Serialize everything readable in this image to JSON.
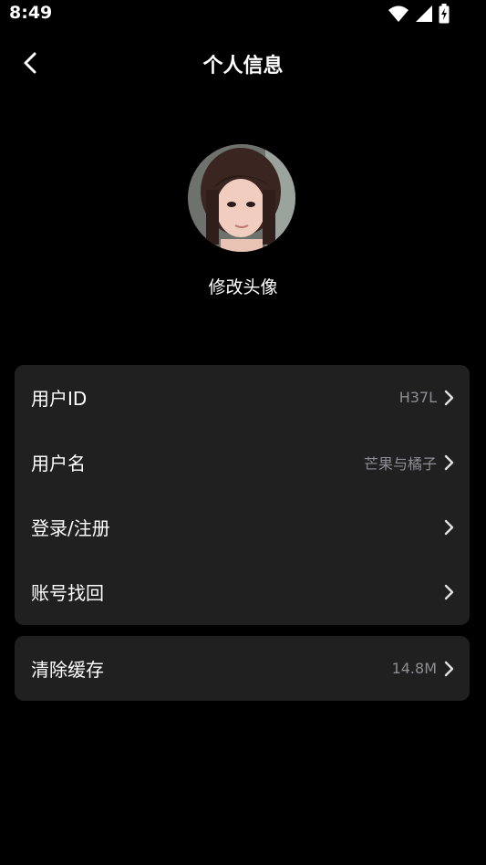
{
  "status_bar": {
    "time": "8:49",
    "icons": [
      "wifi-icon",
      "signal-icon",
      "battery-charging-icon"
    ]
  },
  "header": {
    "back_icon": "chevron-left-icon",
    "title": "个人信息"
  },
  "profile": {
    "change_avatar_label": "修改头像"
  },
  "settings": {
    "items": [
      {
        "label": "用户ID",
        "value": "H37L"
      },
      {
        "label": "用户名",
        "value": "芒果与橘子"
      },
      {
        "label": "登录/注册",
        "value": ""
      },
      {
        "label": "账号找回",
        "value": ""
      }
    ],
    "cache": {
      "label": "清除缓存",
      "value": "14.8M"
    }
  },
  "colors": {
    "background": "#000000",
    "card": "#202020",
    "secondary_text": "#8d8d93"
  }
}
